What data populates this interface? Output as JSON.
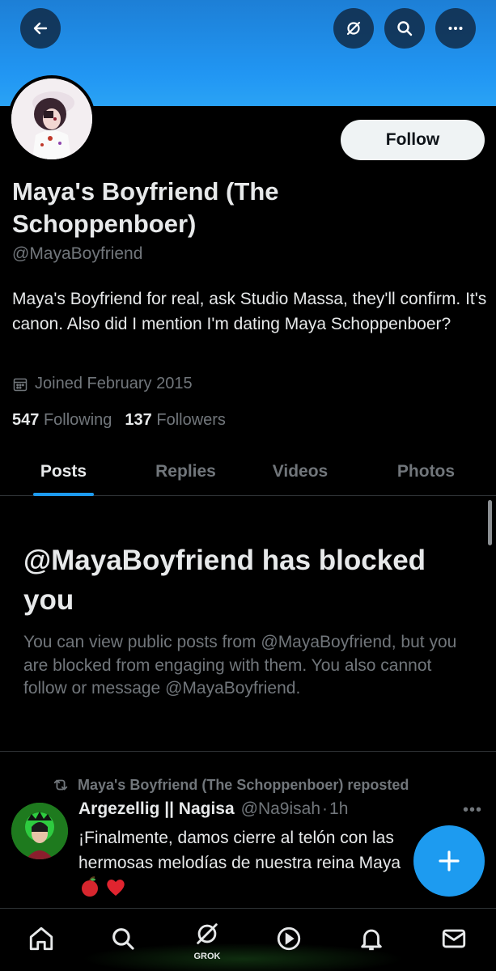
{
  "header": {
    "back_icon": "arrow-left-icon",
    "grok_icon": "grok-slash-icon",
    "search_icon": "search-icon",
    "more_icon": "more-horizontal-icon",
    "banner_color": "#2196f3"
  },
  "profile": {
    "follow_label": "Follow",
    "display_name": "Maya's Boyfriend (The Schoppenboer)",
    "handle": "@MayaBoyfriend",
    "bio": "Maya's Boyfriend for real, ask Studio Massa, they'll confirm. It's canon. Also did I mention I'm dating Maya Schoppenboer?",
    "joined": "Joined February 2015",
    "following_count": "547",
    "following_label": "Following",
    "followers_count": "137",
    "followers_label": "Followers"
  },
  "tabs": [
    {
      "label": "Posts",
      "active": true
    },
    {
      "label": "Replies",
      "active": false
    },
    {
      "label": "Videos",
      "active": false
    },
    {
      "label": "Photos",
      "active": false
    }
  ],
  "blocked": {
    "title": "@MayaBoyfriend has blocked you",
    "text": "You can view public posts from @MayaBoyfriend, but you are blocked from engaging with them. You also cannot follow or message @MayaBoyfriend."
  },
  "post": {
    "repost_label": "Maya's Boyfriend (The Schoppenboer) reposted",
    "author_name": "Argezellig || Nagisa",
    "author_handle": "@Na9isah",
    "separator": "·",
    "time": "1h",
    "text": "¡Finalmente, damos cierre al telón con las hermosas melodías de nuestra reina Maya",
    "emojis": "🍎❤️",
    "more_label": "•••"
  },
  "bottom_nav": {
    "items": [
      "home-icon",
      "search-icon",
      "grok-icon",
      "play-icon",
      "notifications-icon",
      "messages-icon"
    ],
    "grok_label": "GROK"
  },
  "accent": "#1d9bf0"
}
